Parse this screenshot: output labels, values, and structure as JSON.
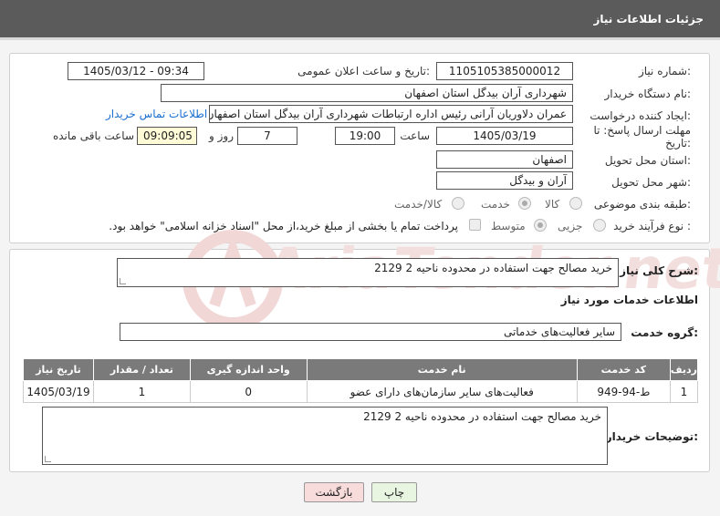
{
  "header": {
    "title": "جزئیات اطلاعات نیاز"
  },
  "info": {
    "need_number_label": "شماره نیاز:",
    "need_number": "1105105385000012",
    "announce_label": "تاریخ و ساعت اعلان عمومی:",
    "announce_value": "1405/03/12 - 09:34",
    "buyer_org_label": "نام دستگاه خریدار:",
    "buyer_org": "شهرداری آران بیدگل استان اصفهان",
    "creator_label": "ایجاد کننده درخواست:",
    "creator": "عمران دلاوریان آرانی رئیس اداره ارتباطات شهرداری آران بیدگل استان اصفهان",
    "contact_link": "اطلاعات تماس خریدار",
    "deadline_label": "مهلت ارسال پاسخ: تا تاریخ:",
    "deadline_date": "1405/03/19",
    "time_label": "ساعت",
    "deadline_time": "19:00",
    "days_value": "7",
    "days_label": "روز و",
    "remaining_time": "09:09:05",
    "remaining_label": "ساعت باقی مانده",
    "province_label": "استان محل تحویل:",
    "province": "اصفهان",
    "city_label": "شهر محل تحویل:",
    "city": "آران و بیدگل",
    "category_label": "طبقه بندی موضوعی:",
    "category_options": [
      "کالا",
      "خدمت",
      "کالا/خدمت"
    ],
    "category_selected": "خدمت",
    "process_label": "نوع فرآیند خرید :",
    "process_options": [
      "جزیی",
      "متوسط"
    ],
    "process_selected": "متوسط",
    "payment_note": "پرداخت تمام یا بخشی از مبلغ خرید،از محل \"اسناد خزانه اسلامی\" خواهد بود."
  },
  "details": {
    "summary_label": "شرح کلی نیاز:",
    "summary": "خرید مصالح جهت استفاده در محدوده ناحیه 2 2129",
    "services_heading": "اطلاعات خدمات مورد نیاز",
    "service_group_label": "گروه خدمت:",
    "service_group": "سایر فعالیت‌های خدماتی",
    "table": {
      "columns": [
        "ردیف",
        "کد خدمت",
        "نام خدمت",
        "واحد اندازه گیری",
        "تعداد / مقدار",
        "تاریخ نیاز"
      ],
      "rows": [
        [
          "1",
          "ط-94-949",
          "فعالیت‌های سایر سازمان‌های دارای عضو",
          "0",
          "1",
          "1405/03/19"
        ]
      ]
    },
    "buyer_notes_label": "توضیحات خریدار:",
    "buyer_notes": "خرید مصالح جهت استفاده در محدوده ناحیه 2 2129"
  },
  "buttons": {
    "print": "چاپ",
    "back": "بازگشت"
  },
  "watermark_text": "AriaTender.net"
}
